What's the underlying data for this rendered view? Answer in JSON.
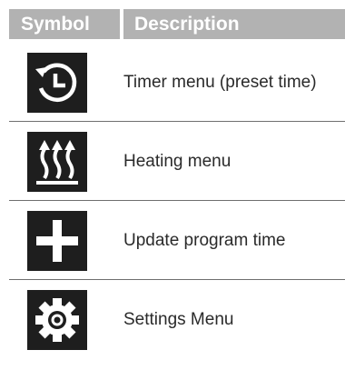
{
  "header": {
    "symbol": "Symbol",
    "description": "Description"
  },
  "rows": [
    {
      "icon": "timer-icon",
      "label": "Timer menu (preset time)"
    },
    {
      "icon": "heating-icon",
      "label": "Heating menu"
    },
    {
      "icon": "plus-icon",
      "label": "Update program time"
    },
    {
      "icon": "gear-icon",
      "label": "Settings Menu"
    }
  ],
  "colors": {
    "header_bg": "#b2b2b2",
    "icon_bg": "#1e1e1e",
    "divider": "#6f6f6f"
  }
}
